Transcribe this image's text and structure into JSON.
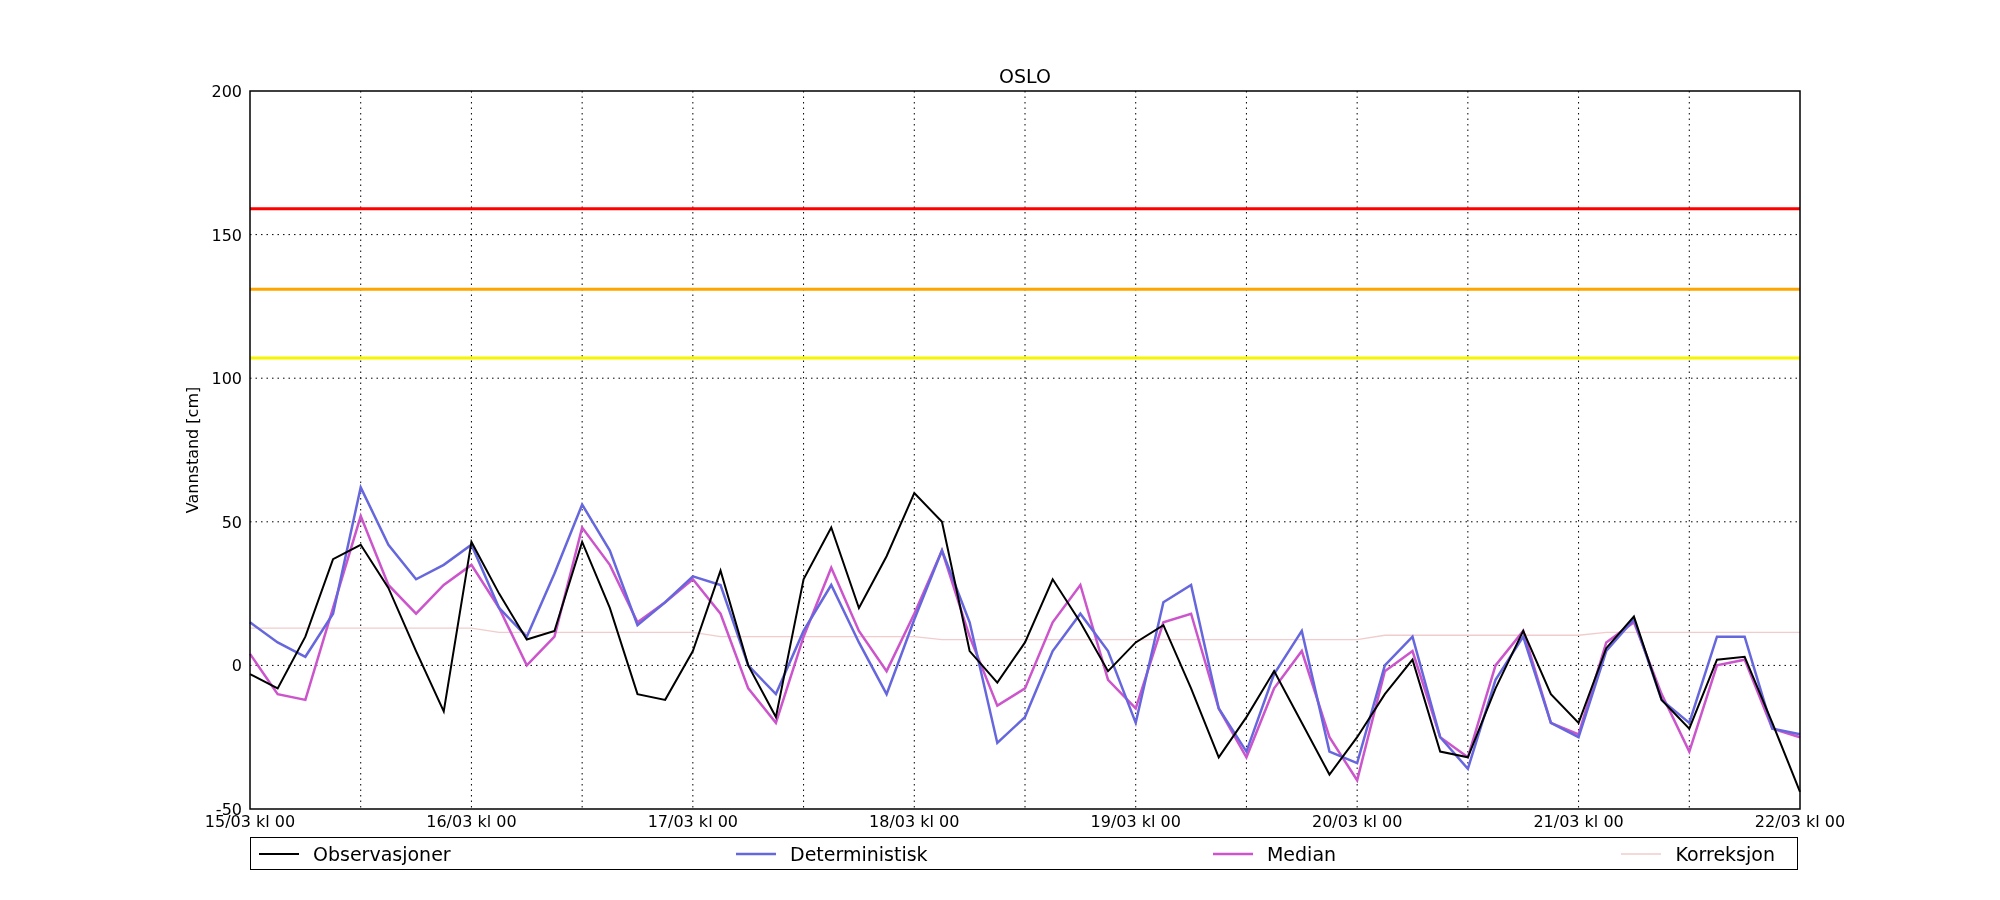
{
  "chart_data": {
    "type": "line",
    "title": "OSLO",
    "ylabel": "Vannstand [cm]",
    "categories": [
      "15/03 kl 00",
      null,
      null,
      null,
      null,
      null,
      null,
      null,
      "16/03 kl 00",
      null,
      null,
      null,
      null,
      null,
      null,
      null,
      "17/03 kl 00",
      null,
      null,
      null,
      null,
      null,
      null,
      null,
      "18/03 kl 00",
      null,
      null,
      null,
      null,
      null,
      null,
      null,
      "19/03 kl 00",
      null,
      null,
      null,
      null,
      null,
      null,
      null,
      "20/03 kl 00",
      null,
      null,
      null,
      null,
      null,
      null,
      null,
      "21/03 kl 00",
      null,
      null,
      null,
      null,
      null,
      null,
      null,
      "22/03 kl 00"
    ],
    "ylim": [
      -50,
      200
    ],
    "yticks": [
      -50,
      0,
      50,
      100,
      150,
      200
    ],
    "series": [
      {
        "name": "Observasjoner",
        "color": "#000000",
        "values": [
          -3,
          -8,
          10,
          37,
          42,
          27,
          5,
          -16,
          43,
          25,
          9,
          12,
          43,
          20,
          -10,
          -12,
          5,
          33,
          0,
          -18,
          30,
          48,
          20,
          38,
          60,
          50,
          5,
          -6,
          8,
          30,
          15,
          -2,
          8,
          14,
          -8,
          -32,
          -18,
          -2,
          -20,
          -38,
          -25,
          -10,
          2,
          -30,
          -32,
          -8,
          12,
          -10,
          -20,
          6,
          17,
          -12,
          -22,
          2,
          3,
          -20,
          -44
        ]
      },
      {
        "name": "Deterministisk",
        "color": "#6666dd",
        "values": [
          15,
          8,
          3,
          18,
          62,
          42,
          30,
          35,
          42,
          20,
          10,
          32,
          56,
          40,
          14,
          22,
          31,
          28,
          0,
          -10,
          12,
          28,
          8,
          -10,
          16,
          40,
          15,
          -27,
          -18,
          5,
          18,
          5,
          -20,
          22,
          28,
          -15,
          -30,
          -3,
          12,
          -30,
          -34,
          0,
          10,
          -25,
          -36,
          -5,
          10,
          -20,
          -25,
          5,
          16,
          -12,
          -20,
          10,
          10,
          -22,
          -24
        ]
      },
      {
        "name": "Median",
        "color": "#cc55cc",
        "values": [
          4,
          -10,
          -12,
          20,
          52,
          28,
          18,
          28,
          35,
          20,
          0,
          10,
          48,
          35,
          15,
          22,
          30,
          18,
          -8,
          -20,
          10,
          34,
          12,
          -2,
          18,
          40,
          10,
          -14,
          -8,
          15,
          28,
          -5,
          -15,
          15,
          18,
          -15,
          -32,
          -8,
          5,
          -25,
          -40,
          -2,
          5,
          -25,
          -32,
          0,
          12,
          -20,
          -24,
          8,
          15,
          -10,
          -30,
          0,
          2,
          -22,
          -25
        ]
      },
      {
        "name": "Korreksjon",
        "color": "#f2cccc",
        "values": [
          13,
          13,
          13,
          13,
          13,
          13,
          13,
          13,
          13,
          11.5,
          11.5,
          11.5,
          11.5,
          11.5,
          11.5,
          11.5,
          11.5,
          10,
          10,
          10,
          10,
          10,
          10,
          10,
          10,
          9,
          9,
          9,
          9,
          9,
          9,
          9,
          9,
          9,
          9,
          9,
          9,
          9,
          9,
          9,
          9,
          10.5,
          10.5,
          10.5,
          10.5,
          10.5,
          10.5,
          10.5,
          10.5,
          11.5,
          11.5,
          11.5,
          11.5,
          11.5,
          11.5,
          11.5,
          11.5
        ]
      }
    ],
    "ref_lines": [
      {
        "axis": "y",
        "value": 159,
        "color": "#ff0000"
      },
      {
        "axis": "y",
        "value": 131,
        "color": "#ffa500"
      },
      {
        "axis": "y",
        "value": 107,
        "color": "#f5f500"
      }
    ],
    "grid": true
  }
}
